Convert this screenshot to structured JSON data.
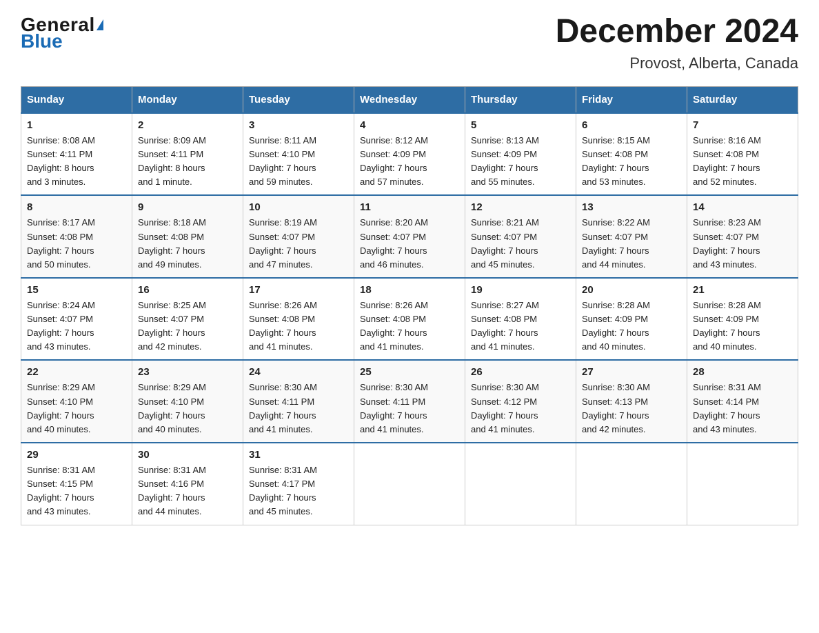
{
  "header": {
    "logo": {
      "general": "General",
      "blue": "Blue",
      "triangle": true
    },
    "title": "December 2024",
    "subtitle": "Provost, Alberta, Canada"
  },
  "weekdays": [
    "Sunday",
    "Monday",
    "Tuesday",
    "Wednesday",
    "Thursday",
    "Friday",
    "Saturday"
  ],
  "weeks": [
    [
      {
        "day": "1",
        "sunrise": "8:08 AM",
        "sunset": "4:11 PM",
        "daylight": "8 hours and 3 minutes."
      },
      {
        "day": "2",
        "sunrise": "8:09 AM",
        "sunset": "4:11 PM",
        "daylight": "8 hours and 1 minute."
      },
      {
        "day": "3",
        "sunrise": "8:11 AM",
        "sunset": "4:10 PM",
        "daylight": "7 hours and 59 minutes."
      },
      {
        "day": "4",
        "sunrise": "8:12 AM",
        "sunset": "4:09 PM",
        "daylight": "7 hours and 57 minutes."
      },
      {
        "day": "5",
        "sunrise": "8:13 AM",
        "sunset": "4:09 PM",
        "daylight": "7 hours and 55 minutes."
      },
      {
        "day": "6",
        "sunrise": "8:15 AM",
        "sunset": "4:08 PM",
        "daylight": "7 hours and 53 minutes."
      },
      {
        "day": "7",
        "sunrise": "8:16 AM",
        "sunset": "4:08 PM",
        "daylight": "7 hours and 52 minutes."
      }
    ],
    [
      {
        "day": "8",
        "sunrise": "8:17 AM",
        "sunset": "4:08 PM",
        "daylight": "7 hours and 50 minutes."
      },
      {
        "day": "9",
        "sunrise": "8:18 AM",
        "sunset": "4:08 PM",
        "daylight": "7 hours and 49 minutes."
      },
      {
        "day": "10",
        "sunrise": "8:19 AM",
        "sunset": "4:07 PM",
        "daylight": "7 hours and 47 minutes."
      },
      {
        "day": "11",
        "sunrise": "8:20 AM",
        "sunset": "4:07 PM",
        "daylight": "7 hours and 46 minutes."
      },
      {
        "day": "12",
        "sunrise": "8:21 AM",
        "sunset": "4:07 PM",
        "daylight": "7 hours and 45 minutes."
      },
      {
        "day": "13",
        "sunrise": "8:22 AM",
        "sunset": "4:07 PM",
        "daylight": "7 hours and 44 minutes."
      },
      {
        "day": "14",
        "sunrise": "8:23 AM",
        "sunset": "4:07 PM",
        "daylight": "7 hours and 43 minutes."
      }
    ],
    [
      {
        "day": "15",
        "sunrise": "8:24 AM",
        "sunset": "4:07 PM",
        "daylight": "7 hours and 43 minutes."
      },
      {
        "day": "16",
        "sunrise": "8:25 AM",
        "sunset": "4:07 PM",
        "daylight": "7 hours and 42 minutes."
      },
      {
        "day": "17",
        "sunrise": "8:26 AM",
        "sunset": "4:08 PM",
        "daylight": "7 hours and 41 minutes."
      },
      {
        "day": "18",
        "sunrise": "8:26 AM",
        "sunset": "4:08 PM",
        "daylight": "7 hours and 41 minutes."
      },
      {
        "day": "19",
        "sunrise": "8:27 AM",
        "sunset": "4:08 PM",
        "daylight": "7 hours and 41 minutes."
      },
      {
        "day": "20",
        "sunrise": "8:28 AM",
        "sunset": "4:09 PM",
        "daylight": "7 hours and 40 minutes."
      },
      {
        "day": "21",
        "sunrise": "8:28 AM",
        "sunset": "4:09 PM",
        "daylight": "7 hours and 40 minutes."
      }
    ],
    [
      {
        "day": "22",
        "sunrise": "8:29 AM",
        "sunset": "4:10 PM",
        "daylight": "7 hours and 40 minutes."
      },
      {
        "day": "23",
        "sunrise": "8:29 AM",
        "sunset": "4:10 PM",
        "daylight": "7 hours and 40 minutes."
      },
      {
        "day": "24",
        "sunrise": "8:30 AM",
        "sunset": "4:11 PM",
        "daylight": "7 hours and 41 minutes."
      },
      {
        "day": "25",
        "sunrise": "8:30 AM",
        "sunset": "4:11 PM",
        "daylight": "7 hours and 41 minutes."
      },
      {
        "day": "26",
        "sunrise": "8:30 AM",
        "sunset": "4:12 PM",
        "daylight": "7 hours and 41 minutes."
      },
      {
        "day": "27",
        "sunrise": "8:30 AM",
        "sunset": "4:13 PM",
        "daylight": "7 hours and 42 minutes."
      },
      {
        "day": "28",
        "sunrise": "8:31 AM",
        "sunset": "4:14 PM",
        "daylight": "7 hours and 43 minutes."
      }
    ],
    [
      {
        "day": "29",
        "sunrise": "8:31 AM",
        "sunset": "4:15 PM",
        "daylight": "7 hours and 43 minutes."
      },
      {
        "day": "30",
        "sunrise": "8:31 AM",
        "sunset": "4:16 PM",
        "daylight": "7 hours and 44 minutes."
      },
      {
        "day": "31",
        "sunrise": "8:31 AM",
        "sunset": "4:17 PM",
        "daylight": "7 hours and 45 minutes."
      },
      null,
      null,
      null,
      null
    ]
  ],
  "labels": {
    "sunrise": "Sunrise:",
    "sunset": "Sunset:",
    "daylight": "Daylight:"
  }
}
